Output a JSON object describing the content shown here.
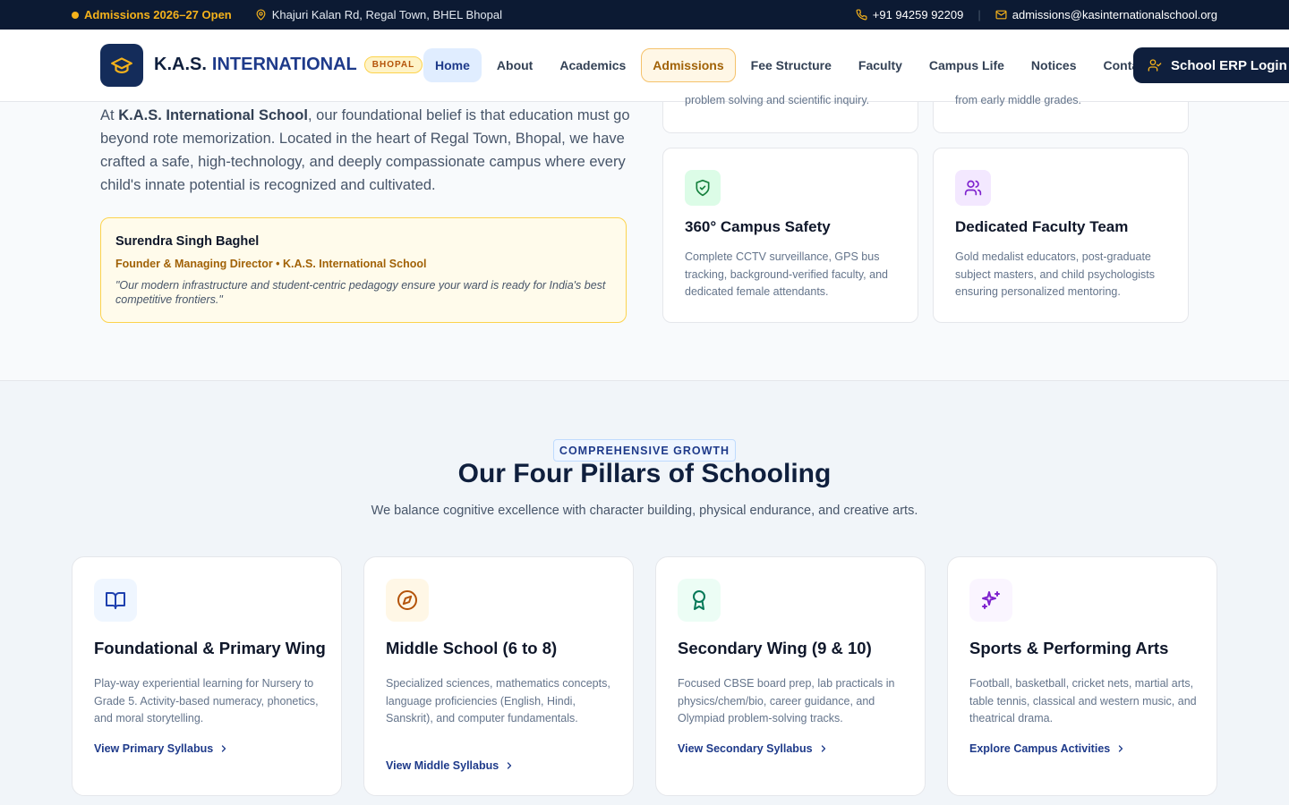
{
  "topbar": {
    "admissions": "Admissions 2026–27 Open",
    "address": "Khajuri Kalan Rd, Regal Town, BHEL Bhopal",
    "phone": "+91 94259 92209",
    "separator": "|",
    "email": "admissions@kasinternationalschool.org"
  },
  "header": {
    "brand_part1": "K.A.S.",
    "brand_part2": "INTERNATIONAL",
    "brand_badge": "BHOPAL",
    "nav": [
      "Home",
      "About",
      "Academics",
      "Admissions",
      "Fee Structure",
      "Faculty",
      "Campus Life",
      "Notices",
      "Contact"
    ],
    "active_nav": "Home",
    "highlight_nav": "Admissions",
    "erp_button": "School ERP Login"
  },
  "about": {
    "intro_prefix": "At ",
    "intro_bold": "K.A.S. International School",
    "intro_rest": ", our foundational belief is that education must go beyond rote memorization. Located in the heart of Regal Town, Bhopal, we have crafted a safe, high-technology, and deeply compassionate campus where every child's innate potential is recognized and cultivated.",
    "founder": {
      "name": "Surendra Singh Baghel",
      "role": "Founder & Managing Director • K.A.S. International School",
      "quote": "\"Our modern infrastructure and student-centric pedagogy ensure your ward is ready for India's best competitive frontiers.\""
    },
    "cut_cards": [
      "problem solving and scientific inquiry.",
      "from early middle grades."
    ],
    "features": [
      {
        "icon": "shield-check-icon",
        "title": "360° Campus Safety",
        "desc": "Complete CCTV surveillance, GPS bus tracking, background-verified faculty, and dedicated female attendants."
      },
      {
        "icon": "users-icon",
        "title": "Dedicated Faculty Team",
        "desc": "Gold medalist educators, post-graduate subject masters, and child psychologists ensuring personalized mentoring."
      }
    ]
  },
  "pillars": {
    "eyebrow": "COMPREHENSIVE GROWTH",
    "title": "Our Four Pillars of Schooling",
    "subtitle": "We balance cognitive excellence with character building, physical endurance, and creative arts.",
    "cards": [
      {
        "icon": "book-open-icon",
        "title": "Foundational & Primary Wing",
        "desc": "Play-way experiential learning for Nursery to Grade 5. Activity-based numeracy, phonetics, and moral storytelling.",
        "link": "View Primary Syllabus"
      },
      {
        "icon": "compass-icon",
        "title": "Middle School (6 to 8)",
        "desc": "Specialized sciences, mathematics concepts, language proficiencies (English, Hindi, Sanskrit), and computer fundamentals.",
        "link": "View Middle Syllabus"
      },
      {
        "icon": "award-icon",
        "title": "Secondary Wing (9 & 10)",
        "desc": "Focused CBSE board prep, lab practicals in physics/chem/bio, career guidance, and Olympiad problem-solving tracks.",
        "link": "View Secondary Syllabus"
      },
      {
        "icon": "sparkles-icon",
        "title": "Sports & Performing Arts",
        "desc": "Football, basketball, cricket nets, martial arts, table tennis, classical and western music, and theatrical drama.",
        "link": "Explore Campus Activities"
      }
    ]
  },
  "colors": {
    "navy": "#0f1f3d",
    "accent_gold": "#f5b21b",
    "link_blue": "#1e3a8a"
  }
}
